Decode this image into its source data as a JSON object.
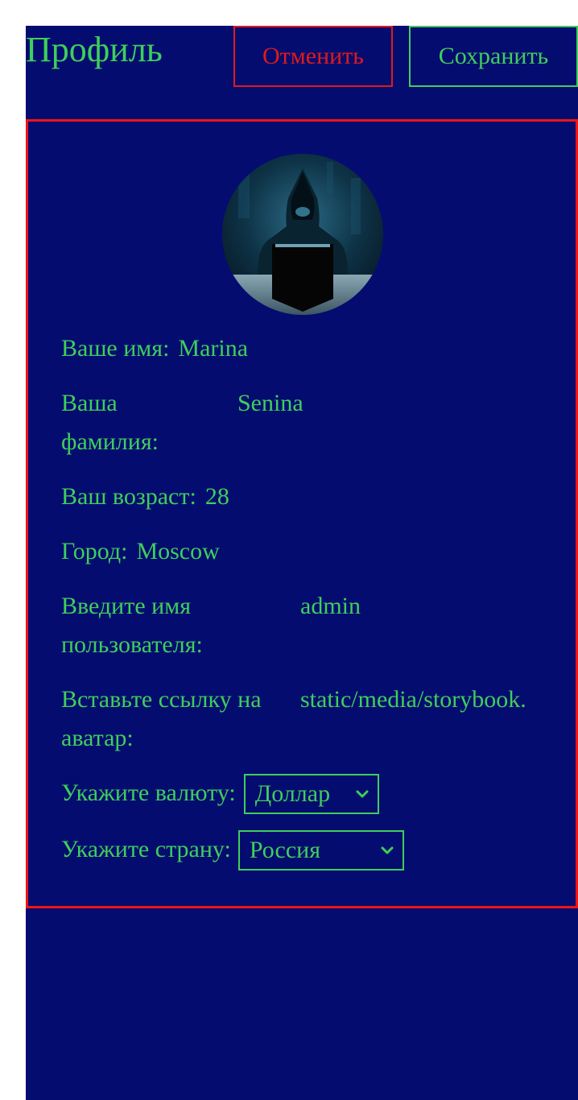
{
  "header": {
    "title": "Профиль",
    "cancel_label": "Отменить",
    "save_label": "Сохранить"
  },
  "profile": {
    "name_label": "Ваше имя:",
    "name_value": "Marina",
    "surname_label": "Ваша фамилия:",
    "surname_value": "Senina",
    "age_label": "Ваш возраст:",
    "age_value": "28",
    "city_label": "Город:",
    "city_value": "Moscow",
    "username_label": "Введите имя пользователя:",
    "username_value": "admin",
    "avatar_label": "Вставьте ссылку на аватар:",
    "avatar_value": "static/media/storybook.",
    "currency_label": "Укажите валюту:",
    "currency_selected": "Доллар",
    "country_label": "Укажите страну:",
    "country_selected": "Россия"
  },
  "colors": {
    "background": "#050c70",
    "accent_green": "#3ecf5a",
    "accent_red": "#e01a1a"
  },
  "icons": {
    "select_arrow": "chevron-down-icon",
    "avatar": "hooded-hacker-avatar"
  }
}
